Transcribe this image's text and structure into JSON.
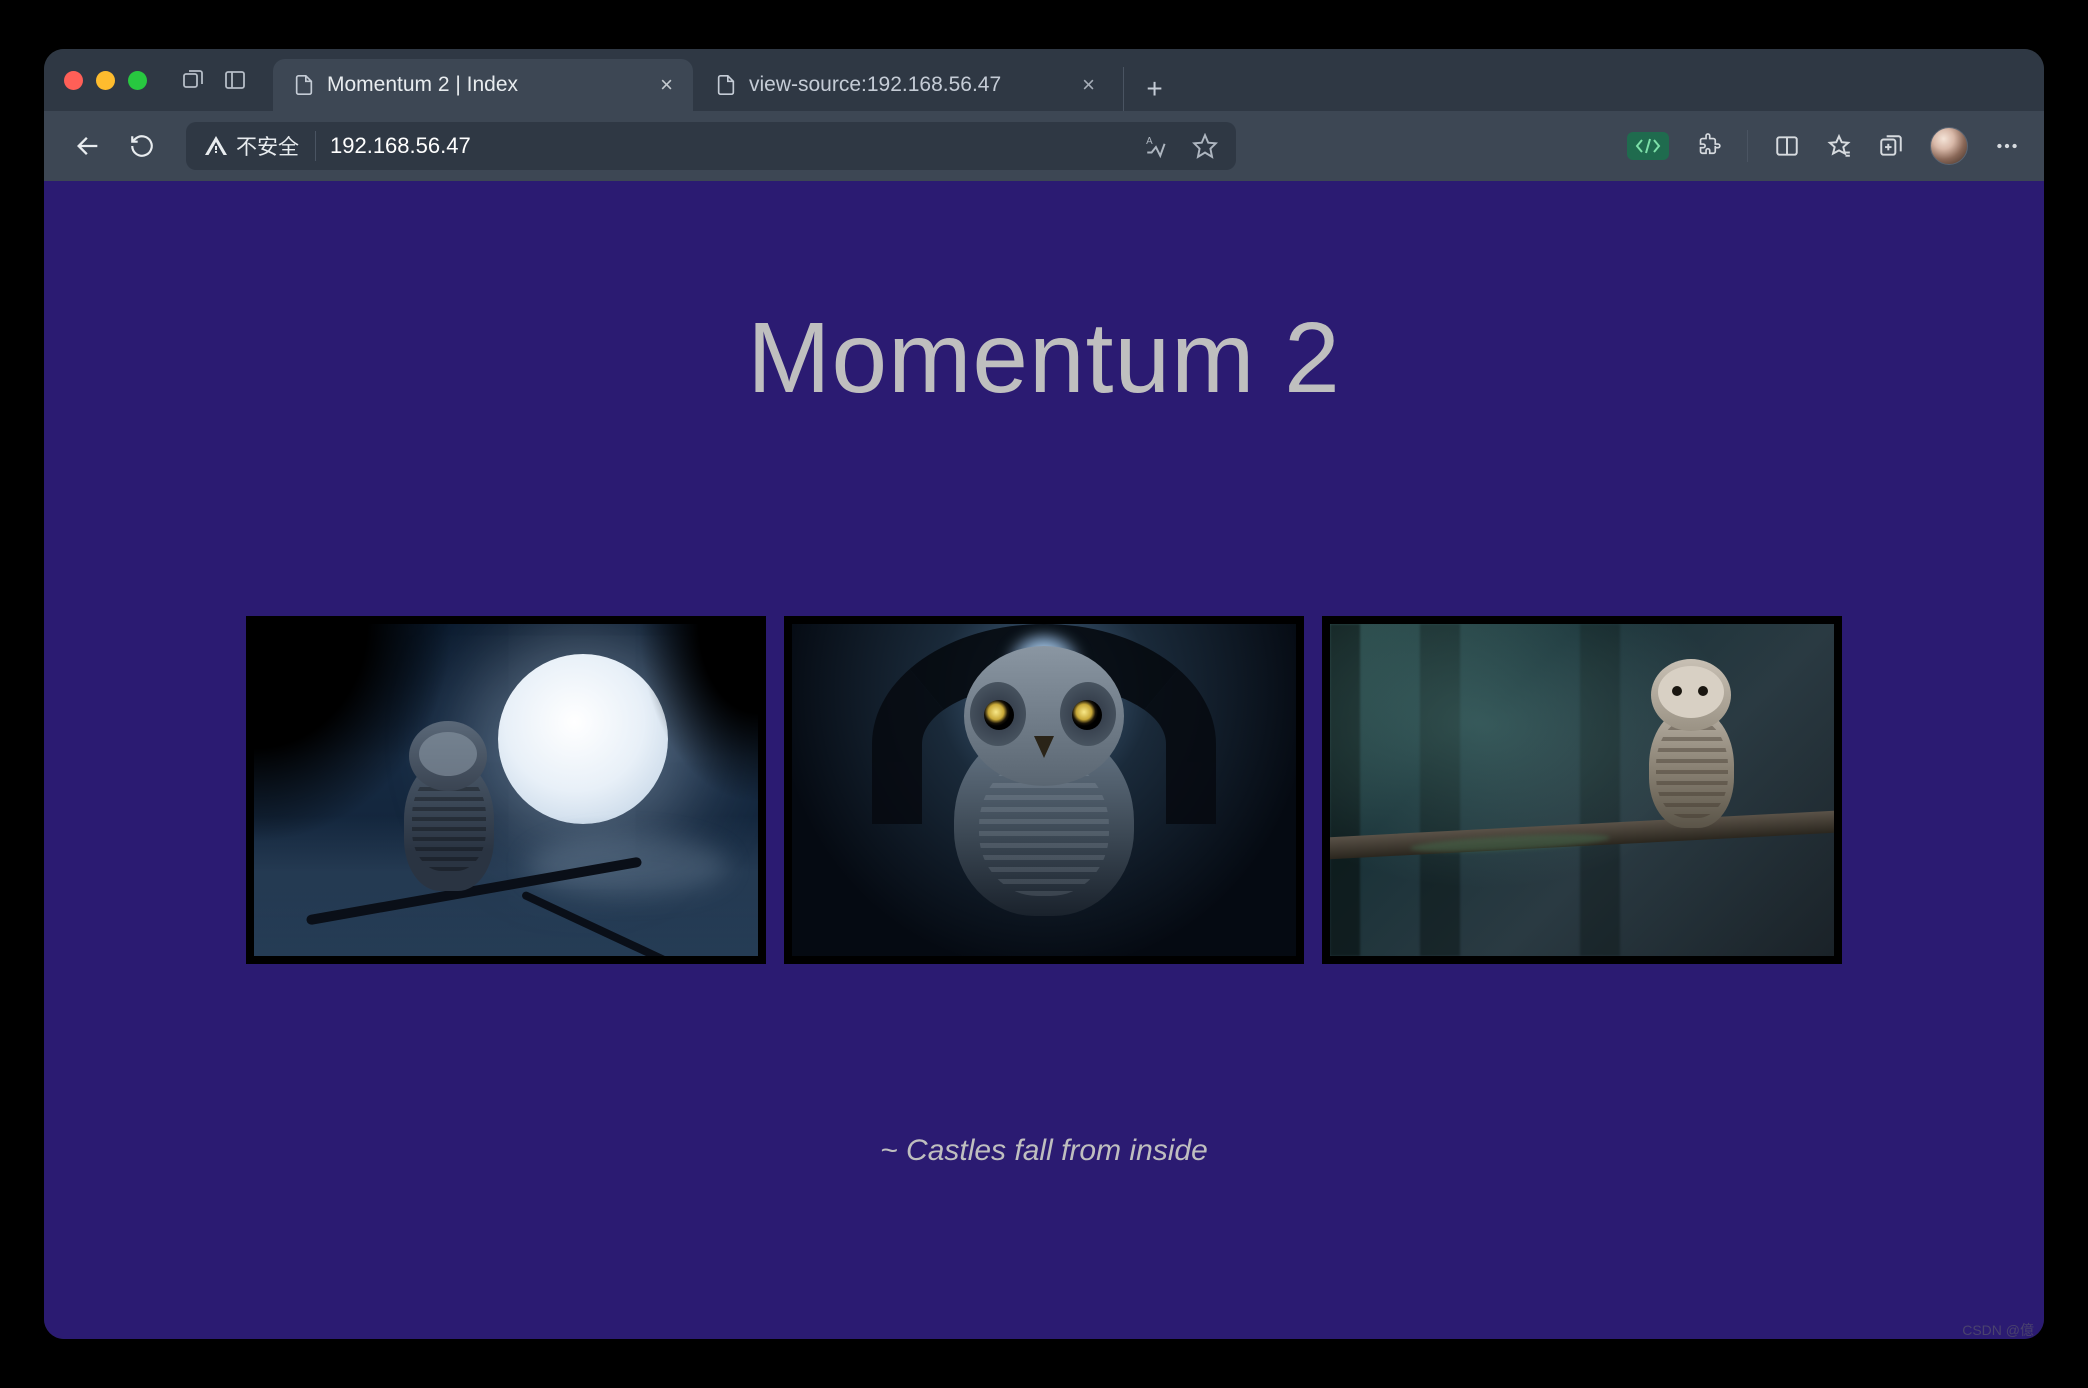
{
  "window": {
    "traffic_lights": [
      "close",
      "minimize",
      "maximize"
    ]
  },
  "tabs": [
    {
      "title": "Momentum 2 | Index",
      "active": true
    },
    {
      "title": "view-source:192.168.56.47",
      "active": false
    }
  ],
  "address_bar": {
    "insecure_label": "不安全",
    "url": "192.168.56.47"
  },
  "toolbar_icons": {
    "back": "back-icon",
    "reload": "reload-icon",
    "read_aloud": "read-aloud-icon",
    "favorite": "star-icon",
    "devtools": "devtools-icon",
    "extensions": "extensions-icon",
    "split": "split-screen-icon",
    "favorites_bar": "favorites-icon",
    "collections": "collections-icon",
    "more": "more-icon"
  },
  "page": {
    "heading": "Momentum 2",
    "images": [
      {
        "alt": "owl on branch under full moon at night"
      },
      {
        "alt": "owl sitting inside a cave with light above"
      },
      {
        "alt": "barred owl on mossy branch in misty forest"
      }
    ],
    "tagline": "~ Castles fall from inside"
  },
  "watermark": "CSDN @億"
}
